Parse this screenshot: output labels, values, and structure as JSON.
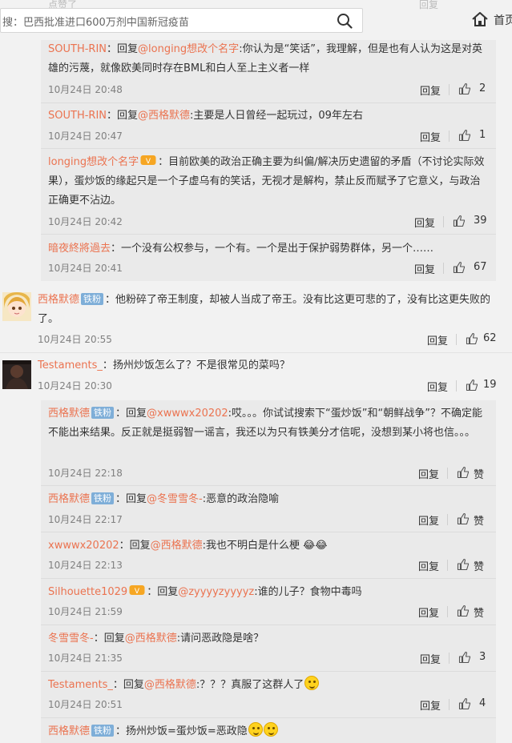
{
  "search": {
    "placeholder": "搜：巴西批准进口600万剂中国新冠疫苗"
  },
  "nav": {
    "home": "首页"
  },
  "ghost": {
    "left": "点赞了",
    "right": "回复"
  },
  "ui": {
    "reply": "回复",
    "reply_prefix": "：回复",
    "colon": "："
  },
  "badges": {
    "tiefen": "铁粉"
  },
  "icons": {
    "search": "search-icon",
    "home": "home-icon",
    "like": "thumbs-up-icon",
    "vip": "vip-badge-icon",
    "emoji": "smile-emoji-icon"
  },
  "colors": {
    "username": "#eb7350",
    "badge": "#7eaed8",
    "panel": "#eaeaea"
  },
  "comments": [
    {
      "user": "SOUTH-RIN",
      "target": "@longing想改个名字",
      "text": ":你认为是“笑话”，我理解，但是也有人认为这是对英雄的污蔑，就像欧美同时存在BML和白人至上主义者一样",
      "time": "10月24日 20:48",
      "likes": "2"
    },
    {
      "user": "SOUTH-RIN",
      "target": "@西格默德",
      "text": ":主要是人日曾经一起玩过，09年左右",
      "time": "10月24日 20:47",
      "likes": "1"
    },
    {
      "user": "longing想改个名字",
      "text": "：目前欧美的政治正确主要为纠偏/解决历史遗留的矛盾（不讨论实际效果），蛋炒饭的缘起只是一个子虚乌有的笑话，无视才是解构，禁止反而赋予了它意义，与政治正确更不沾边。",
      "time": "10月24日 20:42",
      "likes": "39"
    },
    {
      "user": "暗夜終將過去",
      "text": "：一个没有公权参与，一个有。一个是出于保护弱势群体，另一个……",
      "time": "10月24日 20:41",
      "likes": "67"
    },
    {
      "user": "西格默德",
      "text": "：他粉碎了帝王制度，却被人当成了帝王。没有比这更可悲的了，没有比这更失败的了。",
      "time": "10月24日 20:55",
      "likes": "62"
    },
    {
      "user": "Testaments_",
      "text": "：扬州炒饭怎么了？不是很常见的菜吗？",
      "time": "10月24日 20:30",
      "likes": "19"
    },
    {
      "user": "西格默德",
      "target": "@xwwwx20202",
      "text": ":哎。。。你试试搜索下“蛋炒饭”和“朝鲜战争”？不确定能不能出来结果。反正就是挺弱智一谣言，我还以为只有铁美分才信呢，没想到某小将也信。。。",
      "time": "10月24日 22:18",
      "likes": "赞"
    },
    {
      "user": "西格默德",
      "target": "@冬雪雪冬-",
      "text": ":恶意的政治隐喻",
      "time": "10月24日 22:17",
      "likes": "赞"
    },
    {
      "user": "xwwwx20202",
      "target": "@西格默德",
      "text": ":我也不明白是什么梗 😂😂",
      "time": "10月24日 22:13",
      "likes": "赞"
    },
    {
      "user": "Silhouette1029",
      "target": "@zyyyyzyyyyz",
      "text": ":谁的儿子？食物中毒吗",
      "time": "10月24日 21:59",
      "likes": "赞"
    },
    {
      "user": "冬雪雪冬-",
      "target": "@西格默德",
      "text": ":请问恶政隐是啥？",
      "time": "10月24日 21:35",
      "likes": "3"
    },
    {
      "user": "Testaments_",
      "target": "@西格默德",
      "text": ":？？？真服了这群人了",
      "time": "10月24日 20:51",
      "likes": "4"
    },
    {
      "user": "西格默德",
      "text": "：扬州炒饭=蛋炒饭=恶政隐",
      "time": "",
      "likes": ""
    }
  ]
}
